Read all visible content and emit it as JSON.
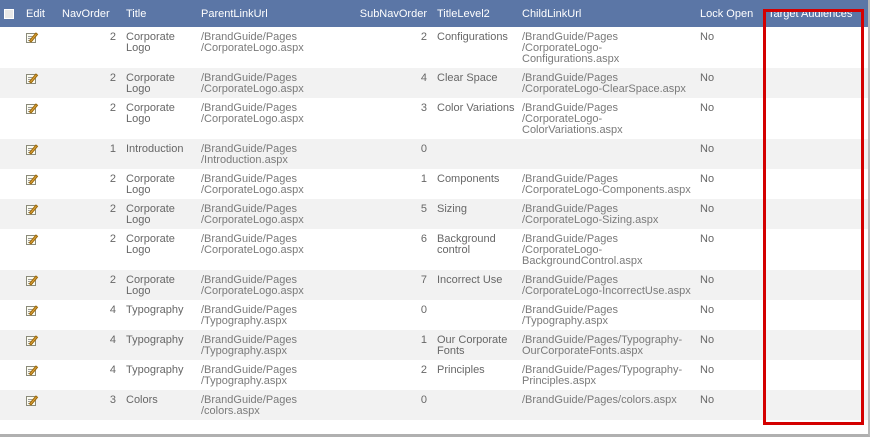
{
  "columns": {
    "edit": "Edit",
    "navorder": "NavOrder",
    "title": "Title",
    "parentlinkurl": "ParentLinkUrl",
    "subnavorder": "SubNavOrder",
    "titlelevel2": "TitleLevel2",
    "childlinkurl": "ChildLinkUrl",
    "lockopen": "Lock Open",
    "targetaudiences": "Target Audiences"
  },
  "rows": [
    {
      "navorder": "2",
      "title": [
        "Corporate",
        "Logo"
      ],
      "parent": [
        "/BrandGuide/Pages",
        "/CorporateLogo.aspx"
      ],
      "subnav": "2",
      "title2": [
        "Configurations"
      ],
      "child": [
        "/BrandGuide/Pages",
        "/CorporateLogo-",
        "Configurations.aspx"
      ],
      "lock": "No",
      "audience": ""
    },
    {
      "navorder": "2",
      "title": [
        "Corporate",
        "Logo"
      ],
      "parent": [
        "/BrandGuide/Pages",
        "/CorporateLogo.aspx"
      ],
      "subnav": "4",
      "title2": [
        "Clear Space"
      ],
      "child": [
        "/BrandGuide/Pages",
        "/CorporateLogo-ClearSpace.aspx"
      ],
      "lock": "No",
      "audience": ""
    },
    {
      "navorder": "2",
      "title": [
        "Corporate",
        "Logo"
      ],
      "parent": [
        "/BrandGuide/Pages",
        "/CorporateLogo.aspx"
      ],
      "subnav": "3",
      "title2": [
        "Color Variations"
      ],
      "child": [
        "/BrandGuide/Pages",
        "/CorporateLogo-",
        "ColorVariations.aspx"
      ],
      "lock": "No",
      "audience": ""
    },
    {
      "navorder": "1",
      "title": [
        "Introduction"
      ],
      "parent": [
        "/BrandGuide/Pages",
        "/Introduction.aspx"
      ],
      "subnav": "0",
      "title2": [],
      "child": [],
      "lock": "No",
      "audience": ""
    },
    {
      "navorder": "2",
      "title": [
        "Corporate",
        "Logo"
      ],
      "parent": [
        "/BrandGuide/Pages",
        "/CorporateLogo.aspx"
      ],
      "subnav": "1",
      "title2": [
        "Components"
      ],
      "child": [
        "/BrandGuide/Pages",
        "/CorporateLogo-Components.aspx"
      ],
      "lock": "No",
      "audience": ""
    },
    {
      "navorder": "2",
      "title": [
        "Corporate",
        "Logo"
      ],
      "parent": [
        "/BrandGuide/Pages",
        "/CorporateLogo.aspx"
      ],
      "subnav": "5",
      "title2": [
        "Sizing"
      ],
      "child": [
        "/BrandGuide/Pages",
        "/CorporateLogo-Sizing.aspx"
      ],
      "lock": "No",
      "audience": ""
    },
    {
      "navorder": "2",
      "title": [
        "Corporate",
        "Logo"
      ],
      "parent": [
        "/BrandGuide/Pages",
        "/CorporateLogo.aspx"
      ],
      "subnav": "6",
      "title2": [
        "Background",
        "control"
      ],
      "child": [
        "/BrandGuide/Pages",
        "/CorporateLogo-",
        "BackgroundControl.aspx"
      ],
      "lock": "No",
      "audience": ""
    },
    {
      "navorder": "2",
      "title": [
        "Corporate",
        "Logo"
      ],
      "parent": [
        "/BrandGuide/Pages",
        "/CorporateLogo.aspx"
      ],
      "subnav": "7",
      "title2": [
        "Incorrect Use"
      ],
      "child": [
        "/BrandGuide/Pages",
        "/CorporateLogo-IncorrectUse.aspx"
      ],
      "lock": "No",
      "audience": ""
    },
    {
      "navorder": "4",
      "title": [
        "Typography"
      ],
      "parent": [
        "/BrandGuide/Pages",
        "/Typography.aspx"
      ],
      "subnav": "0",
      "title2": [],
      "child": [
        "/BrandGuide/Pages",
        "/Typography.aspx"
      ],
      "lock": "No",
      "audience": ""
    },
    {
      "navorder": "4",
      "title": [
        "Typography"
      ],
      "parent": [
        "/BrandGuide/Pages",
        "/Typography.aspx"
      ],
      "subnav": "1",
      "title2": [
        "Our Corporate",
        "Fonts"
      ],
      "child": [
        "/BrandGuide/Pages/Typography-",
        "OurCorporateFonts.aspx"
      ],
      "lock": "No",
      "audience": ""
    },
    {
      "navorder": "4",
      "title": [
        "Typography"
      ],
      "parent": [
        "/BrandGuide/Pages",
        "/Typography.aspx"
      ],
      "subnav": "2",
      "title2": [
        "Principles"
      ],
      "child": [
        "/BrandGuide/Pages/Typography-",
        "Principles.aspx"
      ],
      "lock": "No",
      "audience": ""
    },
    {
      "navorder": "3",
      "title": [
        "Colors"
      ],
      "parent": [
        "/BrandGuide/Pages",
        "/colors.aspx"
      ],
      "subnav": "0",
      "title2": [],
      "child": [
        "/BrandGuide/Pages/colors.aspx"
      ],
      "lock": "No",
      "audience": ""
    }
  ],
  "colors": {
    "header_bg": "#5b76a6",
    "alt_row_bg": "#f2f2f2",
    "highlight_border": "#d40000"
  }
}
